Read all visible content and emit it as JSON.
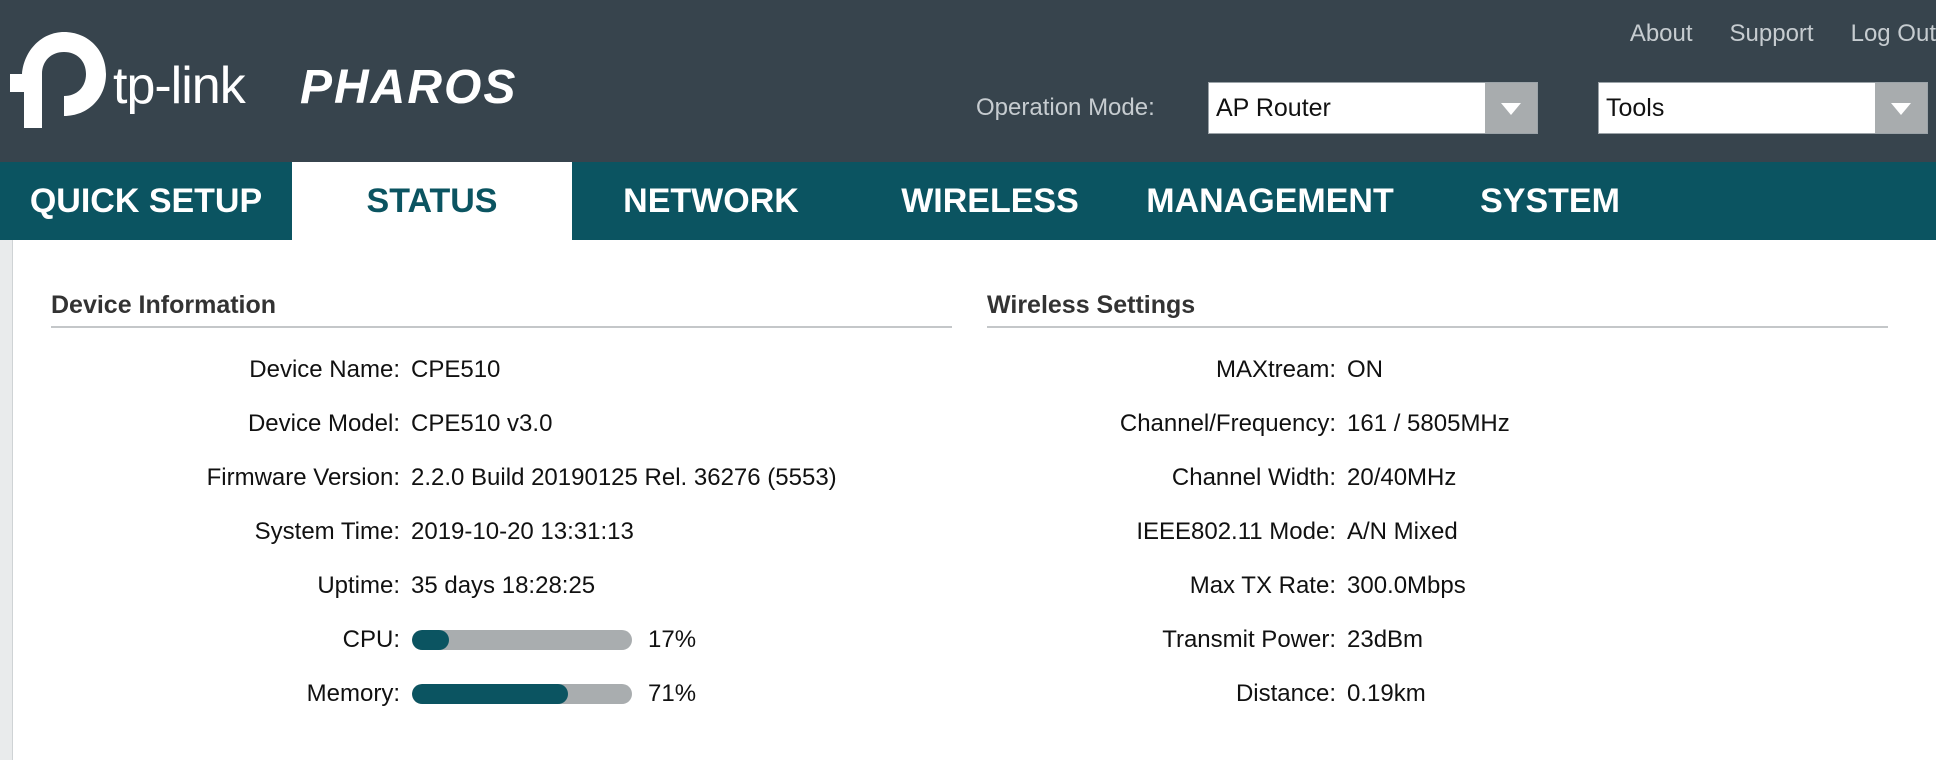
{
  "brand": {
    "logo_text": "tp-link",
    "product": "PHAROS"
  },
  "top_links": [
    "About",
    "Support",
    "Log Out"
  ],
  "operation_mode": {
    "label": "Operation Mode:",
    "selected": "AP Router"
  },
  "tools": {
    "selected": "Tools"
  },
  "nav": {
    "tabs": [
      "QUICK SETUP",
      "STATUS",
      "NETWORK",
      "WIRELESS",
      "MANAGEMENT",
      "SYSTEM"
    ],
    "active": "STATUS"
  },
  "device_info": {
    "title": "Device Information",
    "rows": [
      {
        "label": "Device Name:",
        "value": "CPE510"
      },
      {
        "label": "Device Model:",
        "value": "CPE510 v3.0"
      },
      {
        "label": "Firmware Version:",
        "value": "2.2.0 Build 20190125 Rel. 36276 (5553)"
      },
      {
        "label": "System Time:",
        "value": "2019-10-20 13:31:13"
      },
      {
        "label": "Uptime:",
        "value": "35 days 18:28:25"
      }
    ],
    "cpu": {
      "label": "CPU:",
      "percent": 17,
      "text": "17%"
    },
    "memory": {
      "label": "Memory:",
      "percent": 71,
      "text": "71%"
    }
  },
  "wireless": {
    "title": "Wireless Settings",
    "rows": [
      {
        "label": "MAXtream:",
        "value": "ON"
      },
      {
        "label": "Channel/Frequency:",
        "value": "161 / 5805MHz"
      },
      {
        "label": "Channel Width:",
        "value": "20/40MHz"
      },
      {
        "label": "IEEE802.11 Mode:",
        "value": "A/N Mixed"
      },
      {
        "label": "Max TX Rate:",
        "value": "300.0Mbps"
      },
      {
        "label": "Transmit Power:",
        "value": "23dBm"
      },
      {
        "label": "Distance:",
        "value": "0.19km"
      }
    ]
  },
  "colors": {
    "header_bg": "#37444d",
    "nav_bg": "#0b5461",
    "accent": "#0b5461"
  }
}
